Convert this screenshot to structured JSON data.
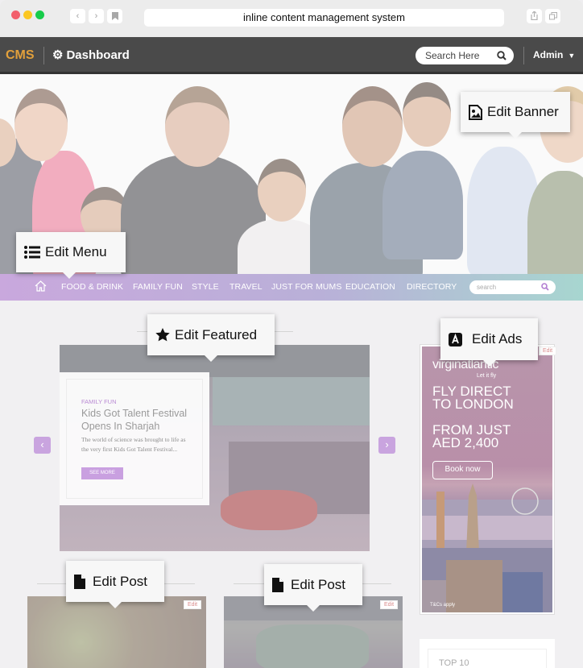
{
  "browser": {
    "url_text": "inline content management system",
    "back_icon": "chevron-left",
    "forward_icon": "chevron-right",
    "bookmark_icon": "bookmark",
    "share_icon": "share",
    "tabs_icon": "tabs"
  },
  "cms_bar": {
    "logo": "CMS",
    "dashboard_label": "Dashboard",
    "search_placeholder": "Search Here",
    "user_label": "Admin"
  },
  "site_nav": {
    "items": [
      "FOOD & DRINK",
      "FAMILY FUN",
      "STYLE",
      "TRAVEL",
      "JUST FOR MUMS",
      "EDUCATION",
      "DIRECTORY"
    ],
    "search_placeholder": "search"
  },
  "featured": {
    "category": "FAMILY FUN",
    "title": "Kids Got Talent Festival Opens In Sharjah",
    "description": "The world of science was brought to life as the very first Kids Got Talent Festival...",
    "button_label": "SEE MORE"
  },
  "ad": {
    "brand": "virginatlantic",
    "tagline": "Let it fly",
    "headline": "FLY DIRECT TO LONDON",
    "price_line": "FROM JUST AED 2,400",
    "button_label": "Book now",
    "terms": "T&Cs apply",
    "edit_label": "Edit"
  },
  "posts": [
    {
      "edit_label": "Edit"
    },
    {
      "edit_label": "Edit"
    }
  ],
  "widget": {
    "title": "TOP 10"
  },
  "tooltips": {
    "edit_banner": "Edit Banner",
    "edit_menu": "Edit Menu",
    "edit_featured": "Edit Featured",
    "edit_ads": "Edit Ads",
    "edit_post_1": "Edit Post",
    "edit_post_2": "Edit Post"
  },
  "colors": {
    "cms_accent": "#e2a03b",
    "nav_gradient_start": "#c9a8dd",
    "nav_gradient_end": "#a7d6d0",
    "site_accent": "#c9a0e0"
  }
}
